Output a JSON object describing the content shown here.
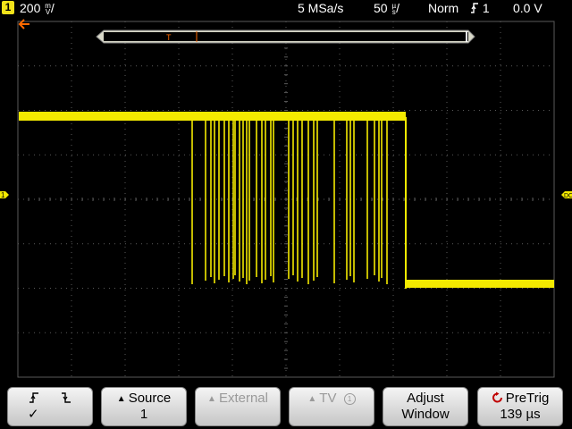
{
  "status": {
    "channel_number": "1",
    "vertical_scale": "200",
    "vertical_unit_top": "m",
    "vertical_unit_bottom": "V",
    "sample_rate": "5 MSa/s",
    "timebase": "50",
    "time_unit_top": "µ",
    "time_unit_bottom": "s",
    "trigger_mode": "Norm",
    "trigger_source": "1",
    "trigger_level": "0.0 V"
  },
  "colors": {
    "trace": "#f4ea00",
    "grid": "#5a5a5a",
    "background": "#000000",
    "trigger_marker": "#ff6a00"
  },
  "screen": {
    "ground_marker": "1",
    "dc_marker": "DC",
    "trigger_position_label": "T"
  },
  "softkeys": [
    {
      "line1": "",
      "line2": "✓",
      "slopes": [
        "rising-edge",
        "falling-edge"
      ],
      "enabled": true
    },
    {
      "line1": "Source",
      "line2": "1",
      "arrow": "▲",
      "enabled": true
    },
    {
      "line1": "External",
      "line2": "",
      "arrow": "▲",
      "enabled": false
    },
    {
      "line1": "TV",
      "line2": "",
      "arrow": "▲",
      "badge": "1",
      "enabled": false
    },
    {
      "line1": "Adjust",
      "line2": "Window",
      "enabled": true
    },
    {
      "line1": "PreTrig",
      "line2": "139 µs",
      "icon": "rotate-knob-icon",
      "enabled": true
    }
  ]
}
